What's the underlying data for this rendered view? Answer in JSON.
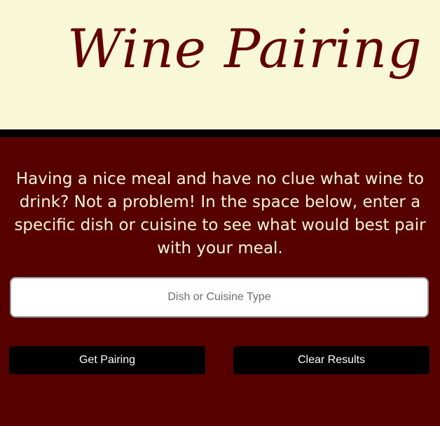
{
  "header": {
    "title": "Wine Pairing"
  },
  "main": {
    "intro": "Having a nice meal and have no clue what wine to drink? Not a problem! In the space below, enter a specific dish or cuisine to see what would best pair with your meal.",
    "search": {
      "placeholder": "Dish or Cuisine Type",
      "value": ""
    },
    "buttons": {
      "get_pairing": "Get Pairing",
      "clear_results": "Clear Results"
    }
  },
  "colors": {
    "header_bg": "#f8f7d6",
    "title": "#650000",
    "main_bg": "#560000",
    "divider": "#000000",
    "button_bg": "#000000",
    "button_text": "#ffffff"
  }
}
